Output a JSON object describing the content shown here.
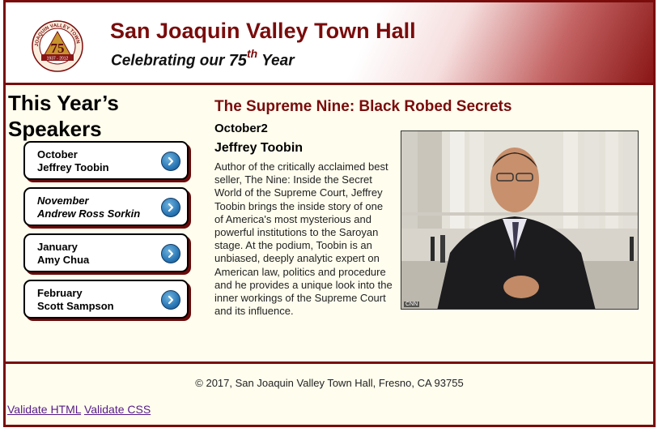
{
  "header": {
    "title": "San Joaquin Valley Town Hall",
    "tagline_before": "Celebrating our ",
    "tagline_number": "75",
    "tagline_suffix": "th",
    "tagline_after": " Year",
    "logo": {
      "icon": "town-hall-75-seal",
      "ring_text": "SAN JOAQUIN VALLEY TOWN HALL",
      "years": "1937 - 2012",
      "center_number": "75"
    }
  },
  "sidebar": {
    "heading_line1": "This Year’s",
    "heading_line2": "Speakers",
    "speakers": [
      {
        "month": "October",
        "name": "Jeffrey Toobin",
        "italic": false
      },
      {
        "month": "November",
        "name": "Andrew Ross Sorkin",
        "italic": true
      },
      {
        "month": "January",
        "name": "Amy Chua",
        "italic": false
      },
      {
        "month": "February",
        "name": "Scott Sampson",
        "italic": false
      }
    ]
  },
  "main": {
    "title": "The Supreme Nine: Black Robed Secrets",
    "date": "October2",
    "speaker": "Jeffrey Toobin",
    "description": "Author of the critically acclaimed best seller, The Nine: Inside the Secret World of the Supreme Court, Jeffrey Toobin brings the inside story of one of America's most mysterious and powerful institutions to the Saroyan stage. At the podium, Toobin is an unbiased, deeply analytic expert on American law, politics and procedure and he provides a unique look into the inner workings of the Supreme Court and its influence.",
    "photo_credit": "CNN"
  },
  "footer": {
    "copyright": "© 2017, San Joaquin Valley Town Hall, Fresno, CA 93755",
    "validate_html": "Validate HTML",
    "validate_css": "Validate CSS"
  },
  "colors": {
    "brand": "#7a0c0c",
    "background": "#fffdee",
    "button_blue": "#2a77b6",
    "link": "#551a8b"
  }
}
